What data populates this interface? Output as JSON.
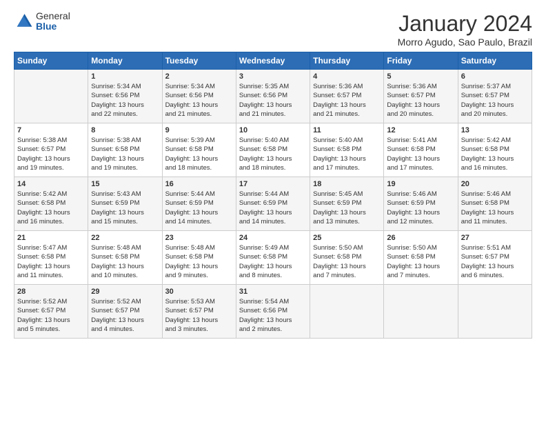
{
  "header": {
    "logo_general": "General",
    "logo_blue": "Blue",
    "title": "January 2024",
    "location": "Morro Agudo, Sao Paulo, Brazil"
  },
  "weekdays": [
    "Sunday",
    "Monday",
    "Tuesday",
    "Wednesday",
    "Thursday",
    "Friday",
    "Saturday"
  ],
  "weeks": [
    [
      {
        "day": "",
        "text": ""
      },
      {
        "day": "1",
        "text": "Sunrise: 5:34 AM\nSunset: 6:56 PM\nDaylight: 13 hours\nand 22 minutes."
      },
      {
        "day": "2",
        "text": "Sunrise: 5:34 AM\nSunset: 6:56 PM\nDaylight: 13 hours\nand 21 minutes."
      },
      {
        "day": "3",
        "text": "Sunrise: 5:35 AM\nSunset: 6:56 PM\nDaylight: 13 hours\nand 21 minutes."
      },
      {
        "day": "4",
        "text": "Sunrise: 5:36 AM\nSunset: 6:57 PM\nDaylight: 13 hours\nand 21 minutes."
      },
      {
        "day": "5",
        "text": "Sunrise: 5:36 AM\nSunset: 6:57 PM\nDaylight: 13 hours\nand 20 minutes."
      },
      {
        "day": "6",
        "text": "Sunrise: 5:37 AM\nSunset: 6:57 PM\nDaylight: 13 hours\nand 20 minutes."
      }
    ],
    [
      {
        "day": "7",
        "text": "Sunrise: 5:38 AM\nSunset: 6:57 PM\nDaylight: 13 hours\nand 19 minutes."
      },
      {
        "day": "8",
        "text": "Sunrise: 5:38 AM\nSunset: 6:58 PM\nDaylight: 13 hours\nand 19 minutes."
      },
      {
        "day": "9",
        "text": "Sunrise: 5:39 AM\nSunset: 6:58 PM\nDaylight: 13 hours\nand 18 minutes."
      },
      {
        "day": "10",
        "text": "Sunrise: 5:40 AM\nSunset: 6:58 PM\nDaylight: 13 hours\nand 18 minutes."
      },
      {
        "day": "11",
        "text": "Sunrise: 5:40 AM\nSunset: 6:58 PM\nDaylight: 13 hours\nand 17 minutes."
      },
      {
        "day": "12",
        "text": "Sunrise: 5:41 AM\nSunset: 6:58 PM\nDaylight: 13 hours\nand 17 minutes."
      },
      {
        "day": "13",
        "text": "Sunrise: 5:42 AM\nSunset: 6:58 PM\nDaylight: 13 hours\nand 16 minutes."
      }
    ],
    [
      {
        "day": "14",
        "text": "Sunrise: 5:42 AM\nSunset: 6:58 PM\nDaylight: 13 hours\nand 16 minutes."
      },
      {
        "day": "15",
        "text": "Sunrise: 5:43 AM\nSunset: 6:59 PM\nDaylight: 13 hours\nand 15 minutes."
      },
      {
        "day": "16",
        "text": "Sunrise: 5:44 AM\nSunset: 6:59 PM\nDaylight: 13 hours\nand 14 minutes."
      },
      {
        "day": "17",
        "text": "Sunrise: 5:44 AM\nSunset: 6:59 PM\nDaylight: 13 hours\nand 14 minutes."
      },
      {
        "day": "18",
        "text": "Sunrise: 5:45 AM\nSunset: 6:59 PM\nDaylight: 13 hours\nand 13 minutes."
      },
      {
        "day": "19",
        "text": "Sunrise: 5:46 AM\nSunset: 6:59 PM\nDaylight: 13 hours\nand 12 minutes."
      },
      {
        "day": "20",
        "text": "Sunrise: 5:46 AM\nSunset: 6:58 PM\nDaylight: 13 hours\nand 11 minutes."
      }
    ],
    [
      {
        "day": "21",
        "text": "Sunrise: 5:47 AM\nSunset: 6:58 PM\nDaylight: 13 hours\nand 11 minutes."
      },
      {
        "day": "22",
        "text": "Sunrise: 5:48 AM\nSunset: 6:58 PM\nDaylight: 13 hours\nand 10 minutes."
      },
      {
        "day": "23",
        "text": "Sunrise: 5:48 AM\nSunset: 6:58 PM\nDaylight: 13 hours\nand 9 minutes."
      },
      {
        "day": "24",
        "text": "Sunrise: 5:49 AM\nSunset: 6:58 PM\nDaylight: 13 hours\nand 8 minutes."
      },
      {
        "day": "25",
        "text": "Sunrise: 5:50 AM\nSunset: 6:58 PM\nDaylight: 13 hours\nand 7 minutes."
      },
      {
        "day": "26",
        "text": "Sunrise: 5:50 AM\nSunset: 6:58 PM\nDaylight: 13 hours\nand 7 minutes."
      },
      {
        "day": "27",
        "text": "Sunrise: 5:51 AM\nSunset: 6:57 PM\nDaylight: 13 hours\nand 6 minutes."
      }
    ],
    [
      {
        "day": "28",
        "text": "Sunrise: 5:52 AM\nSunset: 6:57 PM\nDaylight: 13 hours\nand 5 minutes."
      },
      {
        "day": "29",
        "text": "Sunrise: 5:52 AM\nSunset: 6:57 PM\nDaylight: 13 hours\nand 4 minutes."
      },
      {
        "day": "30",
        "text": "Sunrise: 5:53 AM\nSunset: 6:57 PM\nDaylight: 13 hours\nand 3 minutes."
      },
      {
        "day": "31",
        "text": "Sunrise: 5:54 AM\nSunset: 6:56 PM\nDaylight: 13 hours\nand 2 minutes."
      },
      {
        "day": "",
        "text": ""
      },
      {
        "day": "",
        "text": ""
      },
      {
        "day": "",
        "text": ""
      }
    ]
  ]
}
